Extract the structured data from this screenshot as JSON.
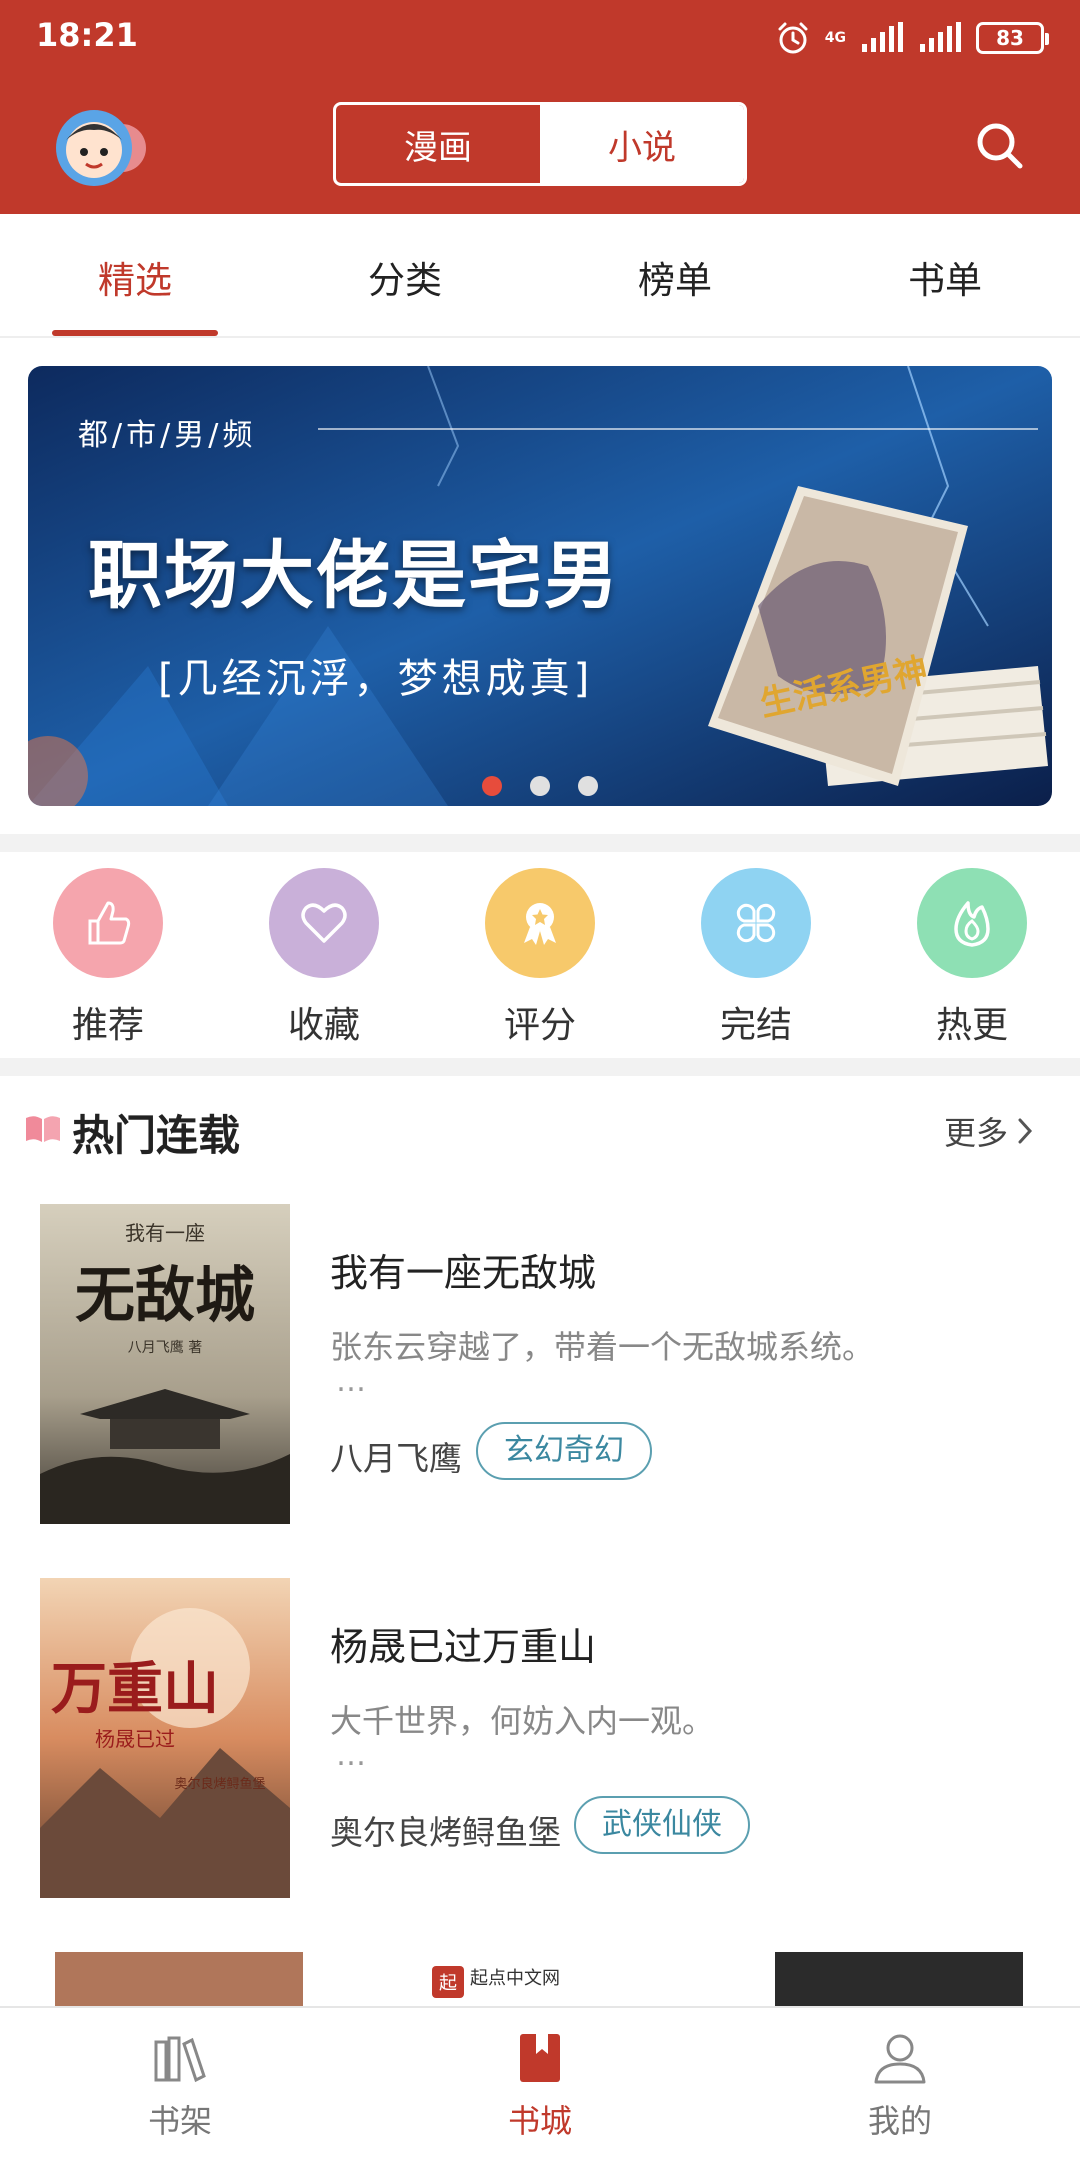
{
  "status_bar": {
    "time": "18:21",
    "network": "4G",
    "battery": "83"
  },
  "header": {
    "segments": [
      {
        "label": "漫画",
        "active": false
      },
      {
        "label": "小说",
        "active": true
      }
    ],
    "accent_color": "#c0392b"
  },
  "tabs": [
    {
      "label": "精选",
      "active": true
    },
    {
      "label": "分类",
      "active": false
    },
    {
      "label": "榜单",
      "active": false
    },
    {
      "label": "书单",
      "active": false
    }
  ],
  "banner": {
    "tag": "都/市/男/频",
    "title": "职场大佬是宅男",
    "subtitle": "[几经沉浮，梦想成真]",
    "book_cover_text": "生活系男神",
    "slides": 3,
    "active_slide": 1
  },
  "categories": [
    {
      "label": "推荐",
      "icon": "thumbs-up-icon",
      "color": "#f5a5ad"
    },
    {
      "label": "收藏",
      "icon": "heart-icon",
      "color": "#c9b0d9"
    },
    {
      "label": "评分",
      "icon": "award-icon",
      "color": "#f7c96b"
    },
    {
      "label": "完结",
      "icon": "grid-flower-icon",
      "color": "#8fd3f2"
    },
    {
      "label": "热更",
      "icon": "flame-icon",
      "color": "#8ee0b4"
    }
  ],
  "section": {
    "title": "热门连载",
    "more": "更多"
  },
  "books": [
    {
      "title": "我有一座无敌城",
      "description": "张东云穿越了，带着一个无敌城系统。",
      "ellipsis": "…",
      "author": "八月飞鹰",
      "genre": "玄幻奇幻",
      "cover_title": "无敌城",
      "cover_top": "我有一座",
      "cover_author": "八月飞鹰 著"
    },
    {
      "title": "杨晟已过万重山",
      "description": "大千世界，何妨入内一观。",
      "ellipsis": "…",
      "author": "奥尔良烤鲟鱼堡",
      "genre": "武侠仙侠",
      "cover_title": "万重山",
      "cover_top": "杨晟已过",
      "cover_author": "奥尔良烤鲟鱼堡"
    }
  ],
  "peek": {
    "center_text": "起点中文网"
  },
  "bottom_nav": [
    {
      "label": "书架",
      "icon": "bookshelf-icon",
      "active": false
    },
    {
      "label": "书城",
      "icon": "book-icon",
      "active": true
    },
    {
      "label": "我的",
      "icon": "user-icon",
      "active": false
    }
  ]
}
